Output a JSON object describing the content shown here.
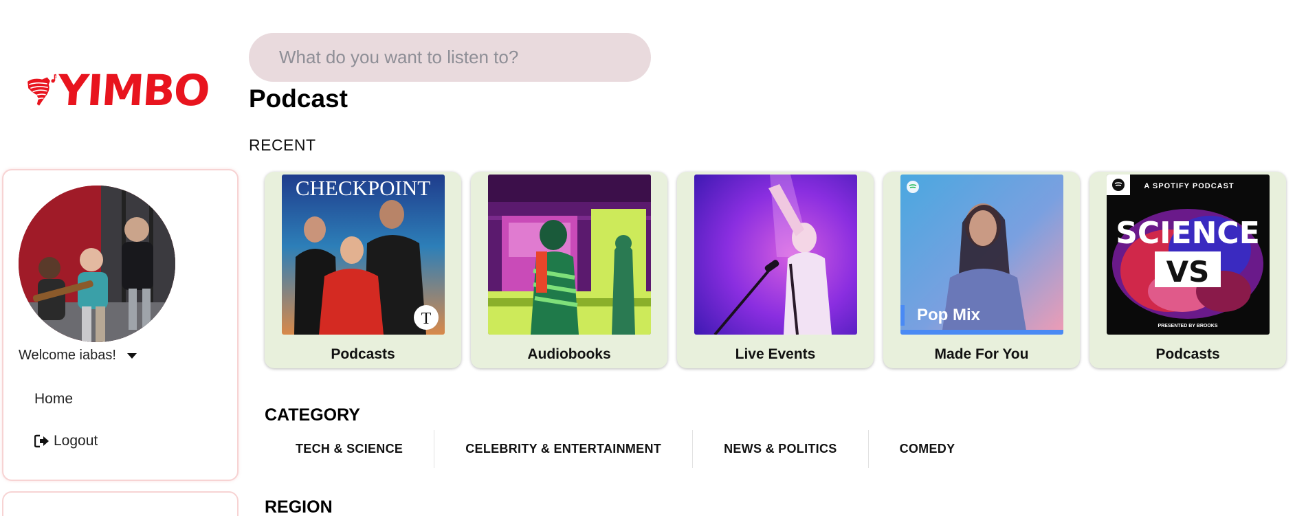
{
  "brand": {
    "name": "YIMBO",
    "color": "#e8141e"
  },
  "search": {
    "placeholder": "What do you want to listen to?"
  },
  "page": {
    "title": "Podcast"
  },
  "sidebar": {
    "welcome": "Welcome iabas!",
    "nav": {
      "home": "Home",
      "logout": "Logout"
    }
  },
  "recent": {
    "heading": "RECENT",
    "cards": [
      {
        "label": "Podcasts",
        "art_title": "CHECKPOINT",
        "badge": "T"
      },
      {
        "label": "Audiobooks"
      },
      {
        "label": "Live Events"
      },
      {
        "label": "Made For You",
        "art_title": "Pop Mix"
      },
      {
        "label": "Podcasts",
        "art_kicker": "A SPOTIFY PODCAST",
        "art_title_1": "SCIENCE",
        "art_title_2": "VS",
        "art_footer": "PRESENTED BY BROOKS"
      }
    ]
  },
  "category": {
    "heading": "CATEGORY",
    "tabs": [
      "TECH & SCIENCE",
      "CELEBRITY & ENTERTAINMENT",
      "NEWS & POLITICS",
      "COMEDY"
    ]
  },
  "region": {
    "heading": "REGION"
  },
  "colors": {
    "card_bg": "#e8f0dc",
    "search_bg": "#e9dadd",
    "panel_border": "#f7d3d3"
  }
}
